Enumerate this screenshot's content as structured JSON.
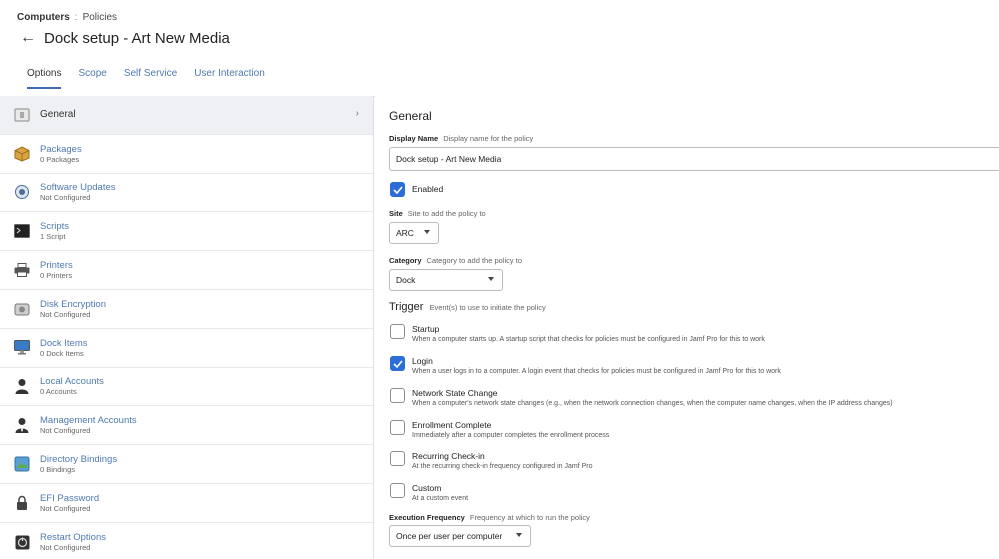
{
  "breadcrumb": {
    "section": "Computers",
    "separator": ":",
    "page": "Policies"
  },
  "page_title": "Dock setup - Art New Media",
  "tabs": [
    {
      "label": "Options",
      "active": true
    },
    {
      "label": "Scope",
      "active": false
    },
    {
      "label": "Self Service",
      "active": false
    },
    {
      "label": "User Interaction",
      "active": false
    }
  ],
  "sidebar": {
    "items": [
      {
        "title": "General",
        "subtitle": "",
        "icon": "general-icon",
        "active": true
      },
      {
        "title": "Packages",
        "subtitle": "0 Packages",
        "icon": "package-icon"
      },
      {
        "title": "Software Updates",
        "subtitle": "Not Configured",
        "icon": "software-update-icon"
      },
      {
        "title": "Scripts",
        "subtitle": "1 Script",
        "icon": "terminal-icon"
      },
      {
        "title": "Printers",
        "subtitle": "0 Printers",
        "icon": "printer-icon"
      },
      {
        "title": "Disk Encryption",
        "subtitle": "Not Configured",
        "icon": "disk-encryption-icon"
      },
      {
        "title": "Dock Items",
        "subtitle": "0 Dock Items",
        "icon": "monitor-icon"
      },
      {
        "title": "Local Accounts",
        "subtitle": "0 Accounts",
        "icon": "user-icon"
      },
      {
        "title": "Management Accounts",
        "subtitle": "Not Configured",
        "icon": "admin-user-icon"
      },
      {
        "title": "Directory Bindings",
        "subtitle": "0 Bindings",
        "icon": "directory-icon"
      },
      {
        "title": "EFI Password",
        "subtitle": "Not Configured",
        "icon": "lock-icon"
      },
      {
        "title": "Restart Options",
        "subtitle": "Not Configured",
        "icon": "restart-icon"
      }
    ]
  },
  "general": {
    "title": "General",
    "display_name": {
      "label": "Display Name",
      "desc": "Display name for the policy",
      "value": "Dock setup - Art New Media"
    },
    "enabled": {
      "label": "Enabled",
      "checked": true
    },
    "site": {
      "label": "Site",
      "desc": "Site to add the policy to",
      "value": "ARC"
    },
    "category": {
      "label": "Category",
      "desc": "Category to add the policy to",
      "value": "Dock"
    },
    "trigger": {
      "title": "Trigger",
      "desc": "Event(s) to use to initiate the policy",
      "options": [
        {
          "label": "Startup",
          "desc": "When a computer starts up. A startup script that checks for policies must be configured in Jamf Pro for this to work",
          "checked": false
        },
        {
          "label": "Login",
          "desc": "When a user logs in to a computer. A login event that checks for policies must be configured in Jamf Pro for this to work",
          "checked": true
        },
        {
          "label": "Network State Change",
          "desc": "When a computer's network state changes (e.g., when the network connection changes, when the computer name changes, when the IP address changes)",
          "checked": false
        },
        {
          "label": "Enrollment Complete",
          "desc": "Immediately after a computer completes the enrollment process",
          "checked": false
        },
        {
          "label": "Recurring Check-in",
          "desc": "At the recurring check-in frequency configured in Jamf Pro",
          "checked": false
        },
        {
          "label": "Custom",
          "desc": "At a custom event",
          "checked": false
        }
      ]
    },
    "execution_frequency": {
      "label": "Execution Frequency",
      "desc": "Frequency at which to run the policy",
      "value": "Once per user per computer"
    }
  },
  "colors": {
    "accent": "#2b6fd6",
    "link": "#4f7ab0"
  }
}
